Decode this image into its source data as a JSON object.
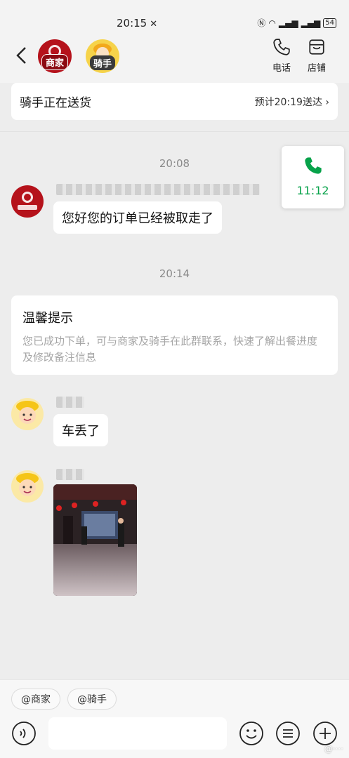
{
  "status": {
    "time": "20:15",
    "battery": "54"
  },
  "header": {
    "merchant_badge": "商家",
    "rider_badge": "骑手",
    "call_label": "电话",
    "store_label": "店铺"
  },
  "delivery": {
    "title": "骑手正在送货",
    "eta": "预计20:19送达 ›"
  },
  "floating_call": {
    "timer": "11:12"
  },
  "messages": [
    {
      "time": "20:08",
      "text": "您好您的订单已经被取走了"
    },
    {
      "time": "20:14"
    },
    {
      "text": "车丢了"
    }
  ],
  "tip": {
    "title": "温馨提示",
    "body": "您已成功下单，可与商家及骑手在此群联系，快速了解出餐进度及修改备注信息"
  },
  "mentions": [
    "@商家",
    "@骑手"
  ],
  "colors": {
    "accent_green": "#07a24a",
    "merchant_red": "#b5121b",
    "rider_yellow": "#f6d34a"
  }
}
